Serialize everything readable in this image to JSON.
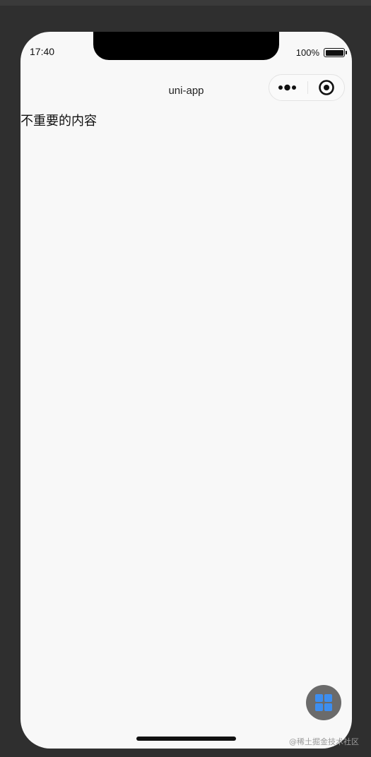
{
  "status_bar": {
    "time": "17:40",
    "battery_percent": "100%",
    "battery_level": 1.0
  },
  "nav": {
    "title": "uni-app"
  },
  "capsule": {
    "more_icon": "more-dots-icon",
    "close_icon": "target-close-icon"
  },
  "main": {
    "text": "不重要的内容"
  },
  "fab": {
    "icon": "grid-icon",
    "color": "#3d8ef0"
  },
  "watermark": {
    "text": "@稀土掘金技术社区"
  }
}
